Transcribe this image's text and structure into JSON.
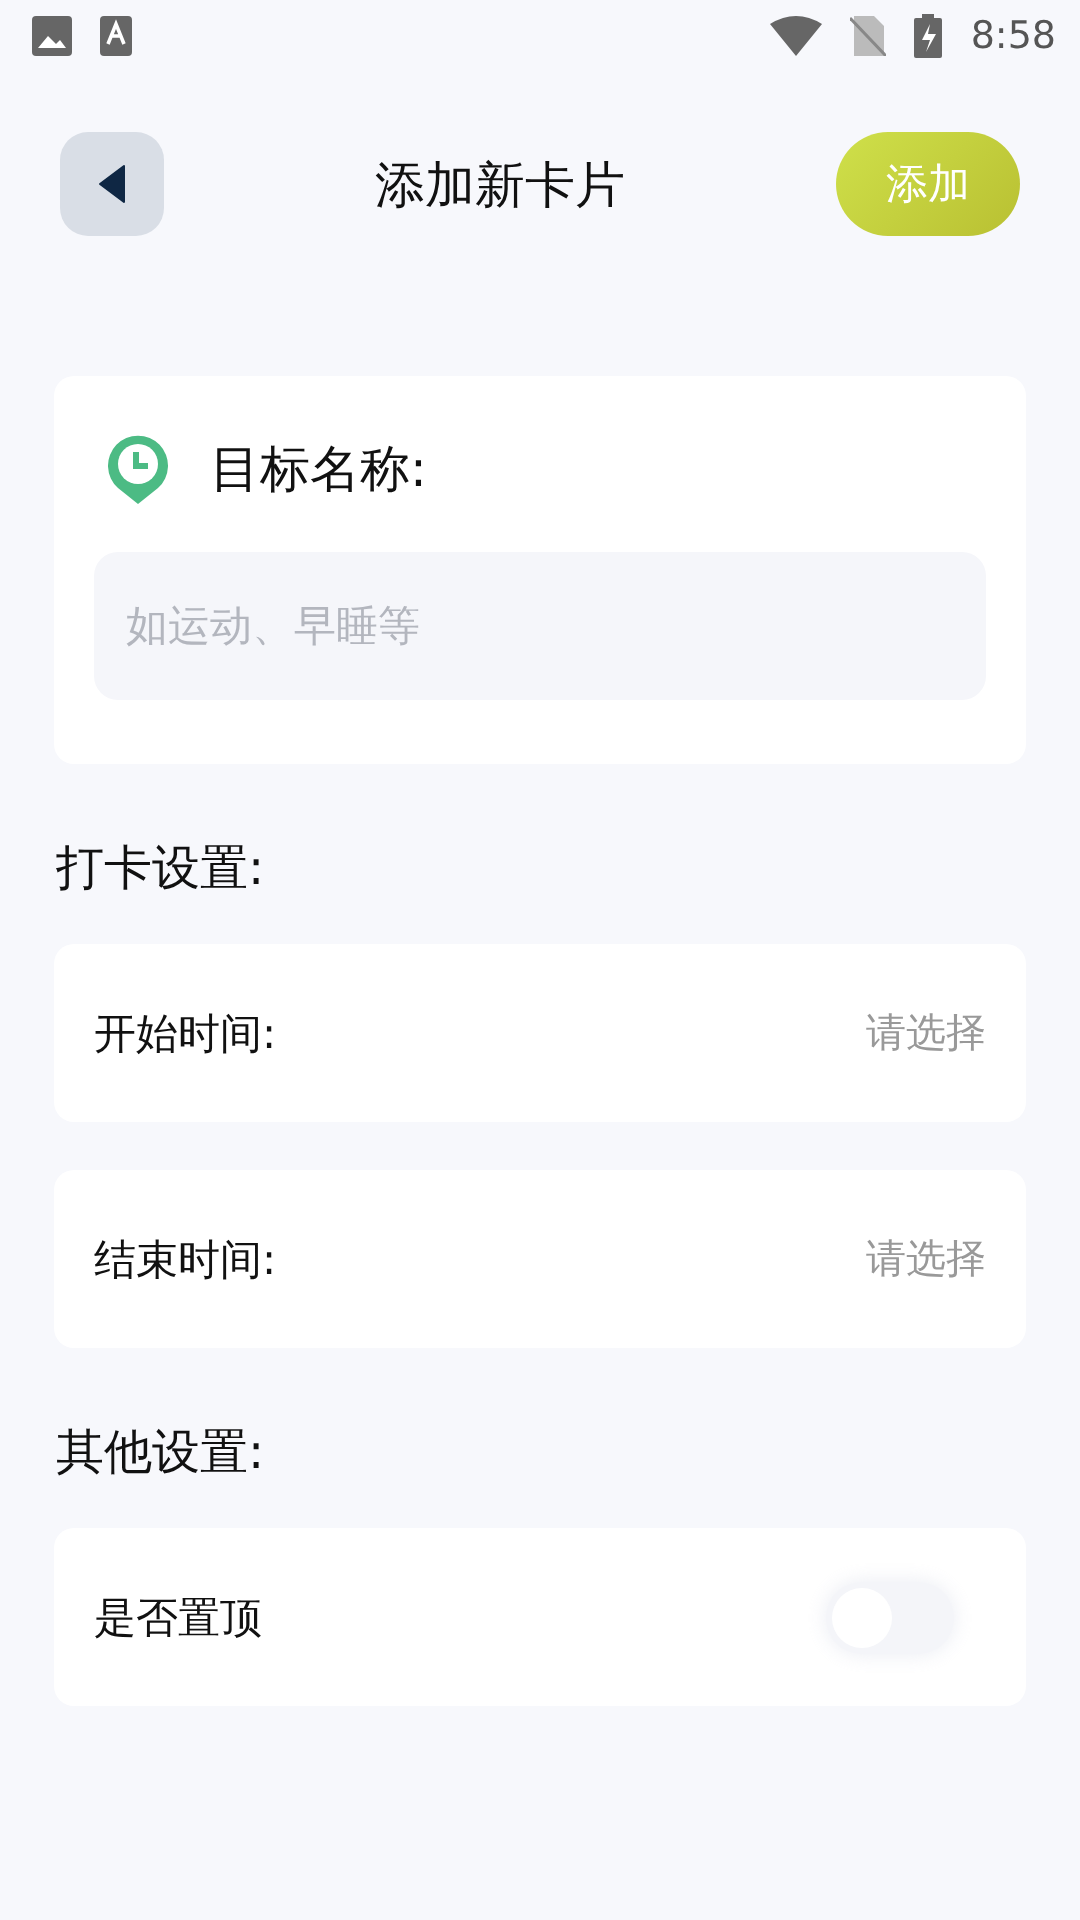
{
  "status_bar": {
    "time": "8:58"
  },
  "header": {
    "title": "添加新卡片",
    "action": "添加"
  },
  "goal": {
    "label": "目标名称:",
    "placeholder": "如运动、早睡等"
  },
  "sections": [
    {
      "title": "打卡设置:",
      "rows": [
        {
          "kind": "picker",
          "label": "开始时间:",
          "value": "请选择"
        },
        {
          "kind": "picker",
          "label": "结束时间:",
          "value": "请选择"
        }
      ]
    },
    {
      "title": "其他设置:",
      "rows": [
        {
          "kind": "switch",
          "label": "是否置顶",
          "on": false
        }
      ]
    }
  ]
}
